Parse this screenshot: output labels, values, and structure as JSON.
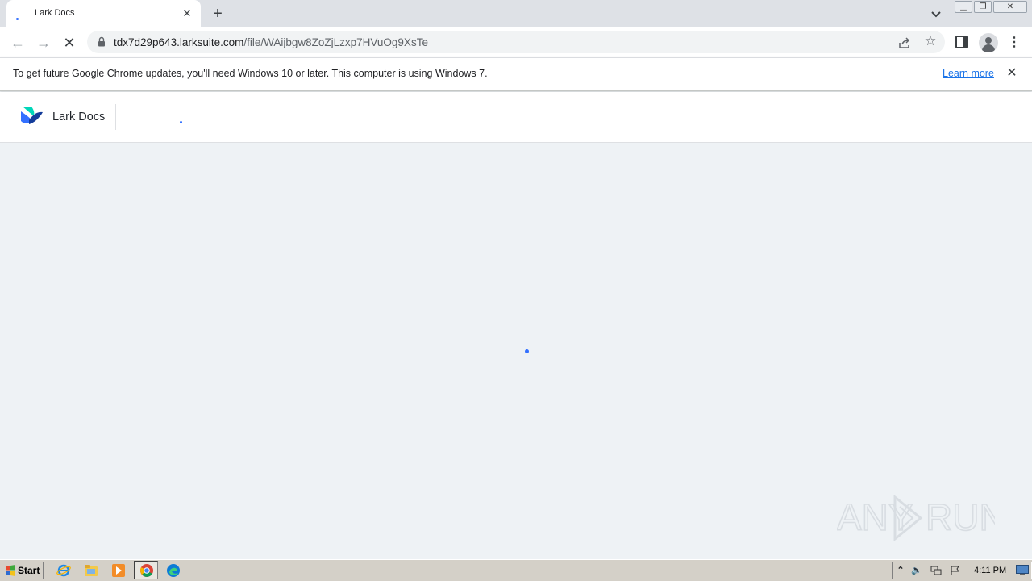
{
  "browser": {
    "tab_title": "Lark Docs",
    "url_host": "tdx7d29p643.larksuite.com",
    "url_path": "/file/WAijbgw8ZoZjLzxp7HVuOg9XsTe",
    "new_tab_glyph": "+",
    "tab_close_glyph": "✕",
    "menu_glyph": "⋮",
    "star_glyph": "☆"
  },
  "infobar": {
    "message": "To get future Google Chrome updates, you'll need Windows 10 or later. This computer is using Windows 7.",
    "link": "Learn more",
    "close_glyph": "✕"
  },
  "app": {
    "name": "Lark Docs",
    "brand_colors": {
      "blue": "#3370ff",
      "teal": "#00d6b9",
      "navy": "#133c9a"
    }
  },
  "taskbar": {
    "start_label": "Start",
    "clock": "4:11 PM"
  },
  "watermark": {
    "left_text": "ANY",
    "right_text": "RUN"
  }
}
